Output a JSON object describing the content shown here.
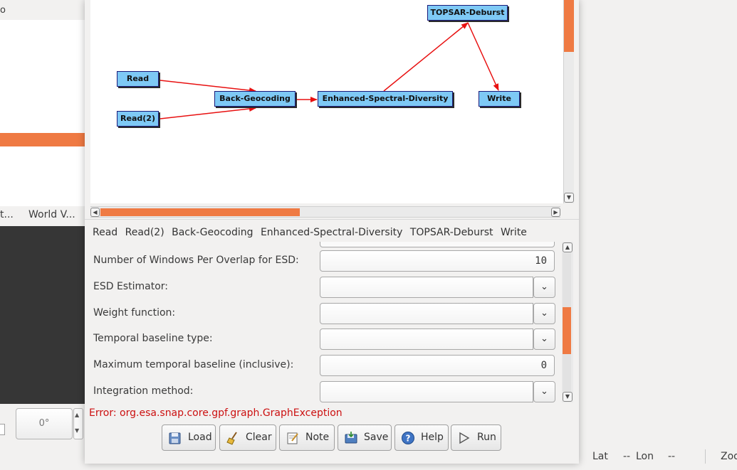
{
  "background_app": {
    "top_left_text": "o",
    "tabs": [
      "t...",
      "World V..."
    ],
    "angle_value": "0°"
  },
  "status_bar": {
    "lat_label": "Lat",
    "lat_value": "--",
    "lon_label": "Lon",
    "lon_value": "--",
    "zoom_label": "Zoo"
  },
  "graph": {
    "nodes": [
      {
        "id": "read",
        "label": "Read"
      },
      {
        "id": "read2",
        "label": "Read(2)"
      },
      {
        "id": "back_geocoding",
        "label": "Back-Geocoding"
      },
      {
        "id": "esd",
        "label": "Enhanced-Spectral-Diversity"
      },
      {
        "id": "deburst",
        "label": "TOPSAR-Deburst"
      },
      {
        "id": "write",
        "label": "Write"
      }
    ],
    "edge_color": "#e81010",
    "node_color": "#7ec9f5"
  },
  "tabs": [
    "Read",
    "Read(2)",
    "Back-Geocoding",
    "Enhanced-Spectral-Diversity",
    "TOPSAR-Deburst",
    "Write"
  ],
  "params": [
    {
      "label": "Number of Windows Per Overlap for ESD:",
      "type": "text",
      "value": "10"
    },
    {
      "label": "ESD Estimator:",
      "type": "combo",
      "value": ""
    },
    {
      "label": "Weight function:",
      "type": "combo",
      "value": ""
    },
    {
      "label": "Temporal baseline type:",
      "type": "combo",
      "value": ""
    },
    {
      "label": "Maximum temporal baseline (inclusive):",
      "type": "text",
      "value": "0"
    },
    {
      "label": "Integration method:",
      "type": "combo",
      "value": ""
    }
  ],
  "error": "Error: org.esa.snap.core.gpf.graph.GraphException",
  "buttons": {
    "load": "Load",
    "clear": "Clear",
    "note": "Note",
    "save": "Save",
    "help": "Help",
    "run": "Run"
  },
  "colors": {
    "accent_orange": "#ef7a43",
    "error_red": "#cc1010"
  }
}
